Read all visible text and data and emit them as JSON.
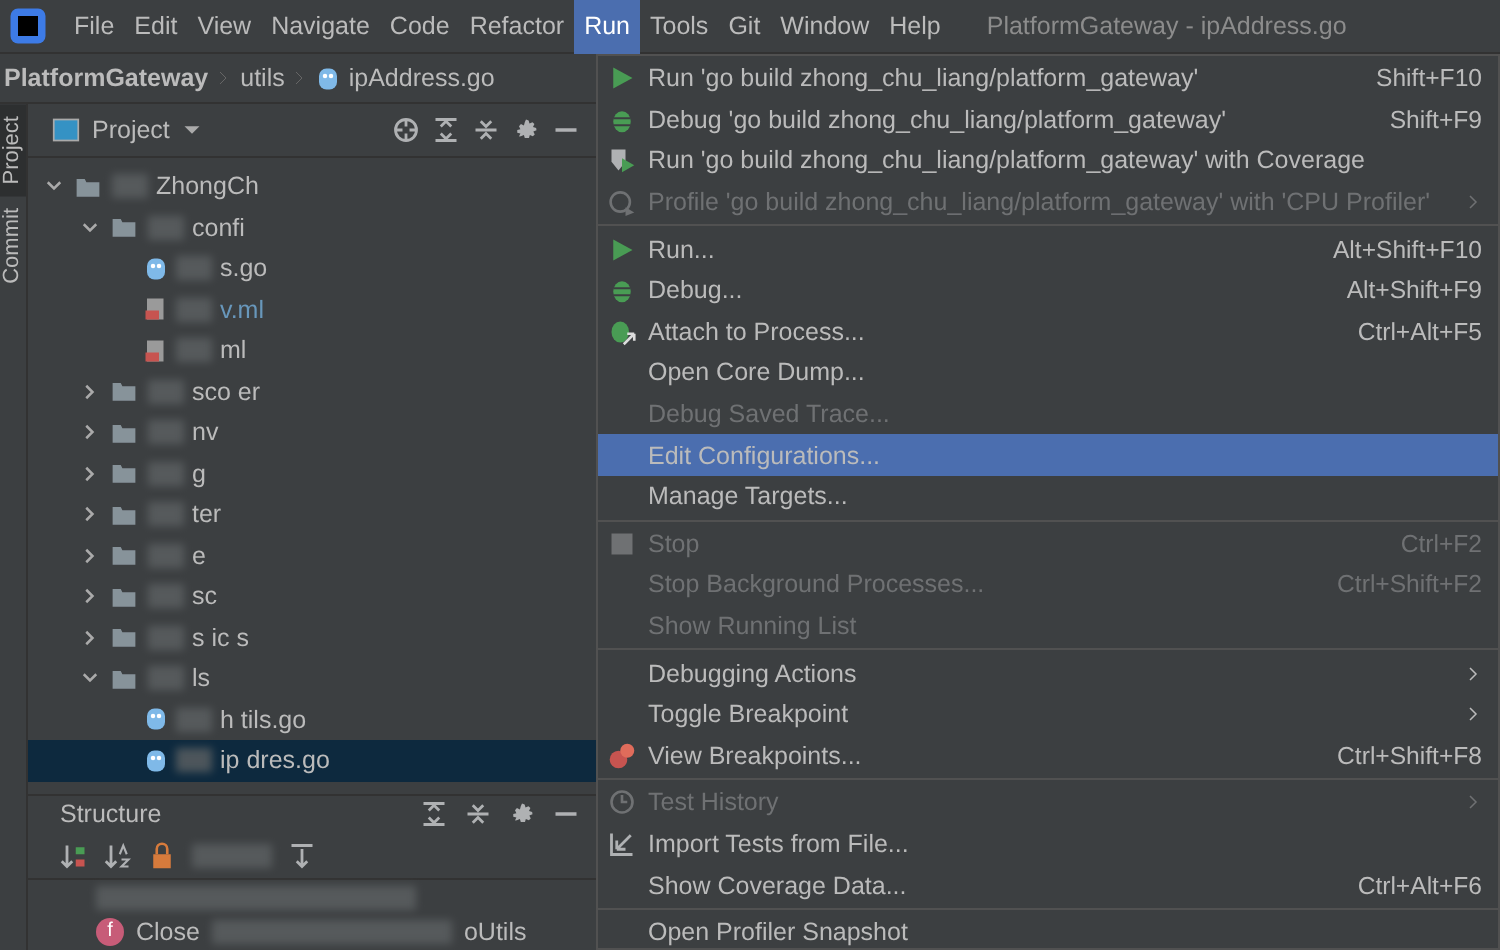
{
  "menubar": {
    "items": [
      {
        "label": "File",
        "selected": false
      },
      {
        "label": "Edit",
        "selected": false
      },
      {
        "label": "View",
        "selected": false
      },
      {
        "label": "Navigate",
        "selected": false
      },
      {
        "label": "Code",
        "selected": false
      },
      {
        "label": "Refactor",
        "selected": false
      },
      {
        "label": "Run",
        "selected": true
      },
      {
        "label": "Tools",
        "selected": false
      },
      {
        "label": "Git",
        "selected": false
      },
      {
        "label": "Window",
        "selected": false
      },
      {
        "label": "Help",
        "selected": false
      }
    ],
    "title": "PlatformGateway - ipAddress.go"
  },
  "breadcrumb": [
    "PlatformGateway",
    "utils",
    "ipAddress.go"
  ],
  "tool_strip": [
    {
      "label": "Project",
      "selected": true
    },
    {
      "label": "Commit",
      "selected": false
    }
  ],
  "project": {
    "title": "Project",
    "tree": [
      {
        "kind": "folder",
        "label": "ZhongCh",
        "blurred": true,
        "expanded": true,
        "selected": false,
        "children": [
          {
            "kind": "folder",
            "label": "confi",
            "blurred": true,
            "expanded": true,
            "selected": false,
            "children": [
              {
                "kind": "go",
                "label": "s.go",
                "blurred": true,
                "selected": false
              },
              {
                "kind": "yaml",
                "label": "v.ml",
                "blurred": true,
                "selected": false,
                "modified": true
              },
              {
                "kind": "yaml",
                "label": "ml",
                "blurred": true,
                "selected": false,
                "modified": false
              }
            ]
          },
          {
            "kind": "folder",
            "label": "sco er",
            "blurred": true,
            "expanded": false,
            "selected": false
          },
          {
            "kind": "folder",
            "label": "nv",
            "blurred": true,
            "expanded": false,
            "selected": false
          },
          {
            "kind": "folder",
            "label": "g",
            "blurred": true,
            "expanded": false,
            "selected": false
          },
          {
            "kind": "folder",
            "label": "ter",
            "blurred": true,
            "expanded": false,
            "selected": false
          },
          {
            "kind": "folder",
            "label": "e",
            "blurred": true,
            "expanded": false,
            "selected": false
          },
          {
            "kind": "folder",
            "label": "sc",
            "blurred": true,
            "expanded": false,
            "selected": false
          },
          {
            "kind": "folder",
            "label": "s ic s",
            "blurred": true,
            "expanded": false,
            "selected": false
          },
          {
            "kind": "folder",
            "label": "ls",
            "blurred": true,
            "expanded": true,
            "selected": false,
            "children": [
              {
                "kind": "go",
                "label": "h tils.go",
                "blurred": true,
                "selected": false
              },
              {
                "kind": "go",
                "label": "ip dres.go",
                "blurred": true,
                "selected": true
              }
            ]
          }
        ]
      }
    ]
  },
  "structure": {
    "title": "Structure",
    "rows": [
      {
        "kind": "blurred"
      },
      {
        "kind": "function",
        "badge": "f",
        "label": "Close",
        "location": "oUtils"
      }
    ]
  },
  "run_menu": [
    {
      "kind": "run",
      "label": "Run 'go build zhong_chu_liang/platform_gateway'",
      "shortcut": "Shift+F10",
      "disabled": false,
      "submenu": false,
      "selected": false
    },
    {
      "kind": "debug",
      "label": "Debug 'go build zhong_chu_liang/platform_gateway'",
      "shortcut": "Shift+F9",
      "disabled": false,
      "submenu": false,
      "selected": false
    },
    {
      "kind": "coverage",
      "label": "Run 'go build zhong_chu_liang/platform_gateway' with Coverage",
      "disabled": false,
      "submenu": false,
      "selected": false
    },
    {
      "kind": "profile",
      "label": "Profile 'go build zhong_chu_liang/platform_gateway' with 'CPU Profiler'",
      "disabled": true,
      "submenu": true,
      "selected": false
    },
    {
      "kind": "separator"
    },
    {
      "kind": "run",
      "label": "Run...",
      "shortcut": "Alt+Shift+F10",
      "disabled": false,
      "submenu": false,
      "selected": false
    },
    {
      "kind": "debug",
      "label": "Debug...",
      "shortcut": "Alt+Shift+F9",
      "disabled": false,
      "submenu": false,
      "selected": false
    },
    {
      "kind": "attach",
      "label": "Attach to Process...",
      "shortcut": "Ctrl+Alt+F5",
      "disabled": false,
      "submenu": false,
      "selected": false
    },
    {
      "kind": "plain",
      "label": "Open Core Dump...",
      "disabled": false,
      "submenu": false,
      "selected": false
    },
    {
      "kind": "plain",
      "label": "Debug Saved Trace...",
      "disabled": true,
      "submenu": false,
      "selected": false
    },
    {
      "kind": "plain",
      "label": "Edit Configurations...",
      "disabled": false,
      "submenu": false,
      "selected": true
    },
    {
      "kind": "plain",
      "label": "Manage Targets...",
      "disabled": false,
      "submenu": false,
      "selected": false
    },
    {
      "kind": "separator"
    },
    {
      "kind": "stop",
      "label": "Stop",
      "shortcut": "Ctrl+F2",
      "disabled": true,
      "submenu": false,
      "selected": false
    },
    {
      "kind": "plain",
      "label": "Stop Background Processes...",
      "shortcut": "Ctrl+Shift+F2",
      "disabled": true,
      "submenu": false,
      "selected": false
    },
    {
      "kind": "plain",
      "label": "Show Running List",
      "disabled": true,
      "submenu": false,
      "selected": false
    },
    {
      "kind": "separator"
    },
    {
      "kind": "plain",
      "label": "Debugging Actions",
      "disabled": false,
      "submenu": true,
      "selected": false
    },
    {
      "kind": "plain",
      "label": "Toggle Breakpoint",
      "disabled": false,
      "submenu": true,
      "selected": false
    },
    {
      "kind": "breakpoints",
      "label": "View Breakpoints...",
      "shortcut": "Ctrl+Shift+F8",
      "disabled": false,
      "submenu": false,
      "selected": false
    },
    {
      "kind": "separator"
    },
    {
      "kind": "history",
      "label": "Test History",
      "disabled": true,
      "submenu": true,
      "selected": false
    },
    {
      "kind": "import",
      "label": "Import Tests from File...",
      "disabled": false,
      "submenu": false,
      "selected": false
    },
    {
      "kind": "plain",
      "label": "Show Coverage Data...",
      "shortcut": "Ctrl+Alt+F6",
      "disabled": false,
      "submenu": false,
      "selected": false
    },
    {
      "kind": "separator"
    },
    {
      "kind": "plain",
      "label": "Open Profiler Snapshot",
      "disabled": false,
      "submenu": false,
      "selected": false
    }
  ]
}
